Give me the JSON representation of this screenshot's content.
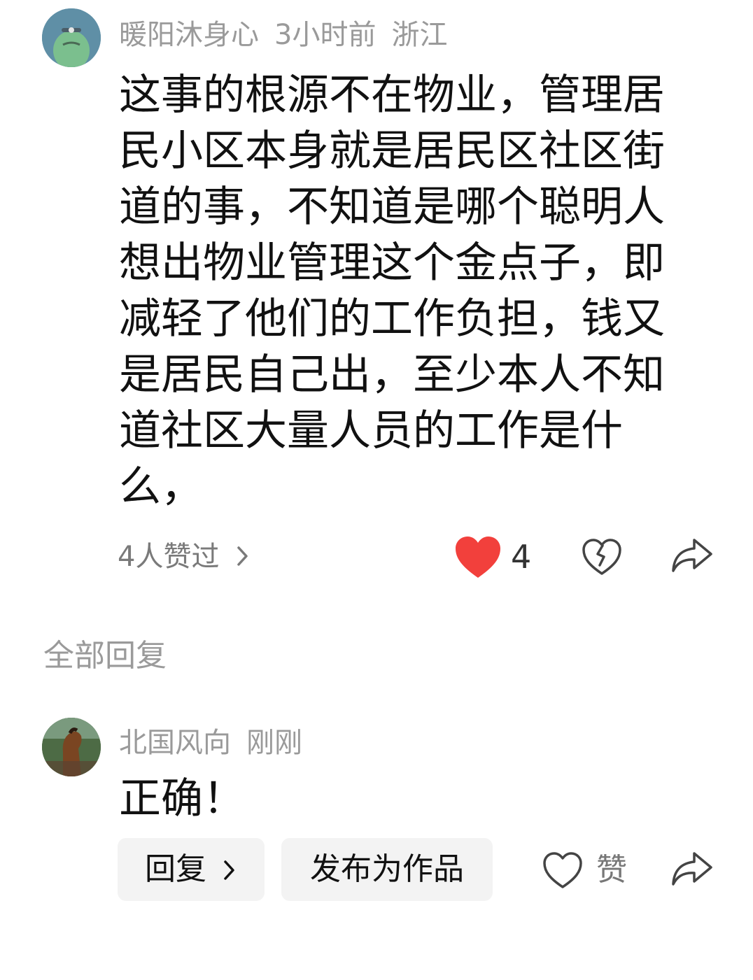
{
  "comment": {
    "author": "暖阳沐身心",
    "time": "3小时前",
    "location": "浙江",
    "text": "这事的根源不在物业，管理居民小区本身就是居民区社区街道的事，不知道是哪个聪明人想出物业管理这个金点子，即减轻了他们的工作负担，钱又是居民自己出，至少本人不知道社区大量人员的工作是什么，",
    "liked_by_label": "4人赞过",
    "like_count": "4",
    "like_color": "#f2403c"
  },
  "replies_section": {
    "title": "全部回复"
  },
  "reply": {
    "author": "北国风向",
    "time": "刚刚",
    "text": "正确！",
    "reply_button": "回复",
    "publish_button": "发布为作品",
    "like_label": "赞"
  },
  "icons": {
    "chevron": "chevron-right-icon",
    "heart_filled": "heart-filled-icon",
    "heart_broken": "heart-broken-icon",
    "share": "share-icon",
    "heart_outline": "heart-outline-icon"
  }
}
